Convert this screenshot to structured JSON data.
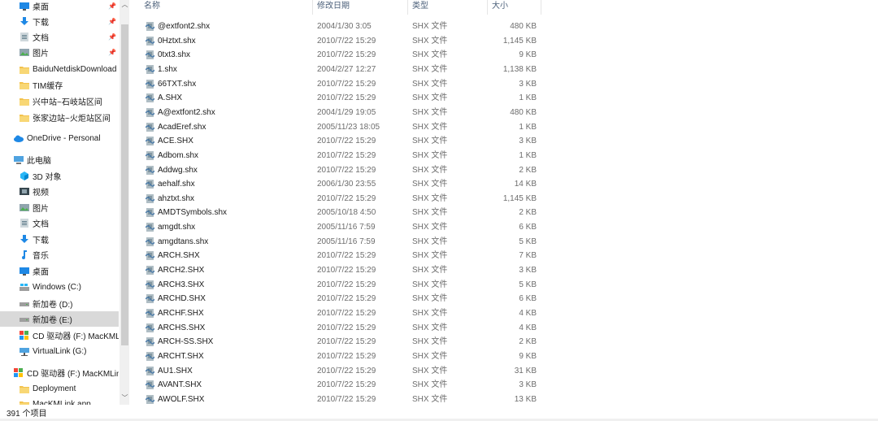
{
  "sidebar": {
    "items": [
      {
        "label": "桌面",
        "icon": "desktop-icon",
        "pinned": true
      },
      {
        "label": "下载",
        "icon": "download-icon",
        "pinned": true
      },
      {
        "label": "文档",
        "icon": "documents-icon",
        "pinned": true
      },
      {
        "label": "图片",
        "icon": "pictures-icon",
        "pinned": true
      },
      {
        "label": "BaiduNetdiskDownload",
        "icon": "folder-icon",
        "pinned": false
      },
      {
        "label": "TIM缓存",
        "icon": "folder-icon",
        "pinned": false
      },
      {
        "label": "兴中站~石岐站区间",
        "icon": "folder-icon",
        "pinned": false
      },
      {
        "label": "张家边站~火炬站区间",
        "icon": "folder-icon",
        "pinned": false
      },
      {
        "label": "OneDrive - Personal",
        "icon": "onedrive-icon",
        "pinned": false
      },
      {
        "label": "此电脑",
        "icon": "this-pc-icon",
        "pinned": false
      },
      {
        "label": "3D 对象",
        "icon": "3d-objects-icon",
        "pinned": false
      },
      {
        "label": "视频",
        "icon": "videos-icon",
        "pinned": false
      },
      {
        "label": "图片",
        "icon": "pictures-icon",
        "pinned": false
      },
      {
        "label": "文档",
        "icon": "documents-icon",
        "pinned": false
      },
      {
        "label": "下载",
        "icon": "download-icon",
        "pinned": false
      },
      {
        "label": "音乐",
        "icon": "music-icon",
        "pinned": false
      },
      {
        "label": "桌面",
        "icon": "desktop-icon",
        "pinned": false
      },
      {
        "label": "Windows (C:)",
        "icon": "windows-drive-icon",
        "pinned": false
      },
      {
        "label": "新加卷 (D:)",
        "icon": "drive-icon",
        "pinned": false
      },
      {
        "label": "新加卷 (E:)",
        "icon": "drive-icon",
        "pinned": false
      },
      {
        "label": "CD 驱动器 (F:) MacKML",
        "icon": "cd-drive-icon",
        "pinned": false
      },
      {
        "label": "VirtualLink (G:)",
        "icon": "network-drive-icon",
        "pinned": false
      },
      {
        "label": "CD 驱动器 (F:) MacKMLin",
        "icon": "cd-drive-icon",
        "pinned": false
      },
      {
        "label": "Deployment",
        "icon": "folder-icon",
        "pinned": false
      },
      {
        "label": "MacKMLink.app",
        "icon": "folder-icon",
        "pinned": false
      }
    ],
    "selected_index": 19
  },
  "header": {
    "name": "名称",
    "date": "修改日期",
    "type": "类型",
    "size": "大小"
  },
  "files": [
    {
      "name": "@extfont2.shx",
      "date": "2004/1/30 3:05",
      "type": "SHX 文件",
      "size": "480 KB"
    },
    {
      "name": "0Hztxt.shx",
      "date": "2010/7/22 15:29",
      "type": "SHX 文件",
      "size": "1,145 KB"
    },
    {
      "name": "0txt3.shx",
      "date": "2010/7/22 15:29",
      "type": "SHX 文件",
      "size": "9 KB"
    },
    {
      "name": "1.shx",
      "date": "2004/2/27 12:27",
      "type": "SHX 文件",
      "size": "1,138 KB"
    },
    {
      "name": "66TXT.shx",
      "date": "2010/7/22 15:29",
      "type": "SHX 文件",
      "size": "3 KB"
    },
    {
      "name": "A.SHX",
      "date": "2010/7/22 15:29",
      "type": "SHX 文件",
      "size": "1 KB"
    },
    {
      "name": "A@extfont2.shx",
      "date": "2004/1/29 19:05",
      "type": "SHX 文件",
      "size": "480 KB"
    },
    {
      "name": "AcadEref.shx",
      "date": "2005/11/23 18:05",
      "type": "SHX 文件",
      "size": "1 KB"
    },
    {
      "name": "ACE.SHX",
      "date": "2010/7/22 15:29",
      "type": "SHX 文件",
      "size": "3 KB"
    },
    {
      "name": "Adbom.shx",
      "date": "2010/7/22 15:29",
      "type": "SHX 文件",
      "size": "1 KB"
    },
    {
      "name": "Addwg.shx",
      "date": "2010/7/22 15:29",
      "type": "SHX 文件",
      "size": "2 KB"
    },
    {
      "name": "aehalf.shx",
      "date": "2006/1/30 23:55",
      "type": "SHX 文件",
      "size": "14 KB"
    },
    {
      "name": "ahztxt.shx",
      "date": "2010/7/22 15:29",
      "type": "SHX 文件",
      "size": "1,145 KB"
    },
    {
      "name": "AMDTSymbols.shx",
      "date": "2005/10/18 4:50",
      "type": "SHX 文件",
      "size": "2 KB"
    },
    {
      "name": "amgdt.shx",
      "date": "2005/11/16 7:59",
      "type": "SHX 文件",
      "size": "6 KB"
    },
    {
      "name": "amgdtans.shx",
      "date": "2005/11/16 7:59",
      "type": "SHX 文件",
      "size": "5 KB"
    },
    {
      "name": "ARCH.SHX",
      "date": "2010/7/22 15:29",
      "type": "SHX 文件",
      "size": "7 KB"
    },
    {
      "name": "ARCH2.SHX",
      "date": "2010/7/22 15:29",
      "type": "SHX 文件",
      "size": "3 KB"
    },
    {
      "name": "ARCH3.SHX",
      "date": "2010/7/22 15:29",
      "type": "SHX 文件",
      "size": "5 KB"
    },
    {
      "name": "ARCHD.SHX",
      "date": "2010/7/22 15:29",
      "type": "SHX 文件",
      "size": "6 KB"
    },
    {
      "name": "ARCHF.SHX",
      "date": "2010/7/22 15:29",
      "type": "SHX 文件",
      "size": "4 KB"
    },
    {
      "name": "ARCHS.SHX",
      "date": "2010/7/22 15:29",
      "type": "SHX 文件",
      "size": "4 KB"
    },
    {
      "name": "ARCH-SS.SHX",
      "date": "2010/7/22 15:29",
      "type": "SHX 文件",
      "size": "2 KB"
    },
    {
      "name": "ARCHT.SHX",
      "date": "2010/7/22 15:29",
      "type": "SHX 文件",
      "size": "9 KB"
    },
    {
      "name": "AU1.SHX",
      "date": "2010/7/22 15:29",
      "type": "SHX 文件",
      "size": "31 KB"
    },
    {
      "name": "AVANT.SHX",
      "date": "2010/7/22 15:29",
      "type": "SHX 文件",
      "size": "3 KB"
    },
    {
      "name": "AWOLF.SHX",
      "date": "2010/7/22 15:29",
      "type": "SHX 文件",
      "size": "13 KB"
    }
  ],
  "status": {
    "item_count": "391 个项目"
  },
  "colors": {
    "folder": "#f3c24d",
    "selected_bg": "#d9d9d9",
    "header_text": "#4c607a",
    "blue_icon": "#1e88e5"
  }
}
